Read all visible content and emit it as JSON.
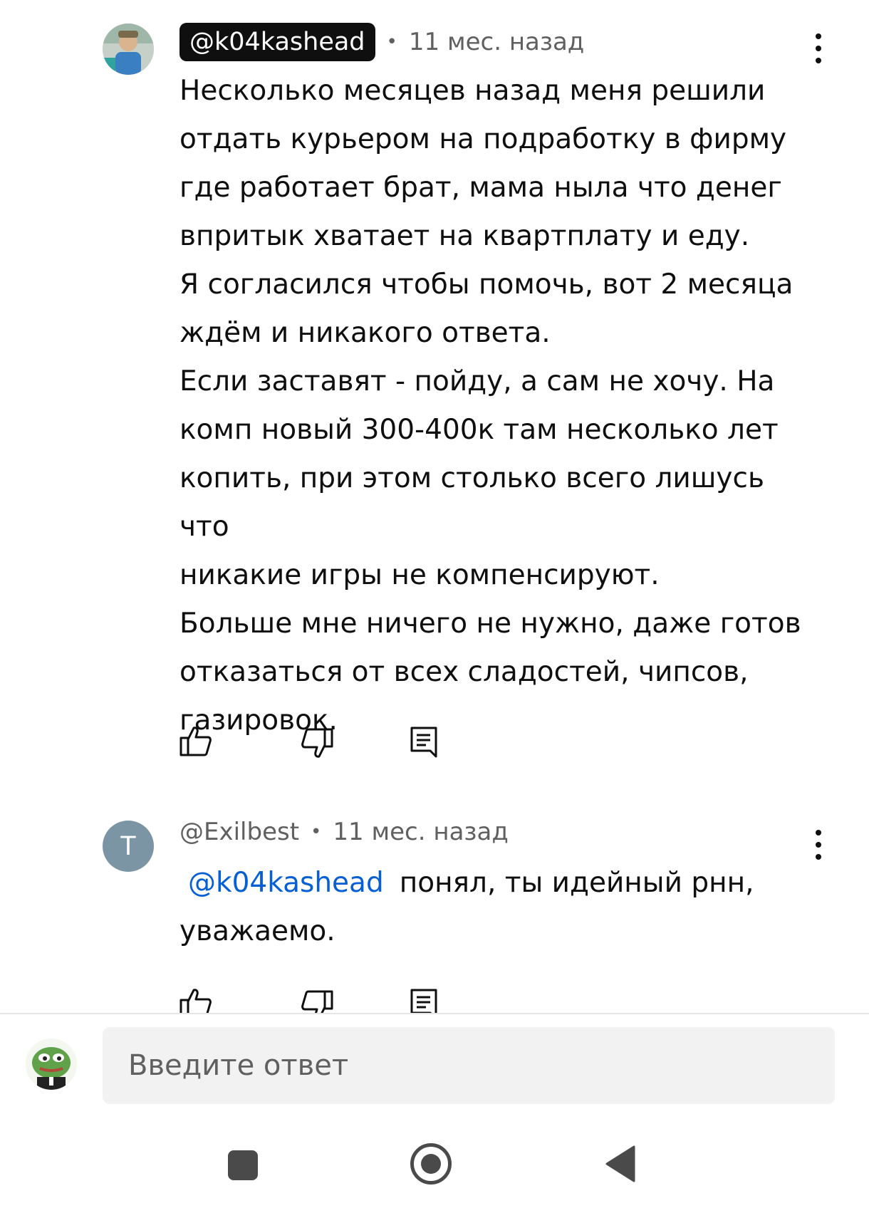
{
  "comments": [
    {
      "handle": "@k04kashead",
      "separator": "•",
      "time": "11 мес. назад",
      "body": "Несколько месяцев назад меня решили\nотдать курьером на подработку в фирму\nгде работает брат, мама ныла что денег\nвпритык хватает на квартплату и еду.\nЯ согласился чтобы помочь, вот 2 месяца\nждём и никакого ответа.\nЕсли заставят - пойду, а сам не хочу. На\nкомп новый 300-400к там несколько лет\nкопить, при этом столько всего лишусь что\nникакие игры не компенсируют.\nБольше мне ничего не нужно, даже готов\nотказаться от всех сладостей, чипсов,\nгазировок."
    },
    {
      "avatar_letter": "T",
      "handle": "@Exilbest",
      "separator": "•",
      "time": "11 мес. назад",
      "mention": "@k04kashead",
      "body_line1": "понял, ты идейный рнн,",
      "body_line2": "уважаемо."
    }
  ],
  "reply_input": {
    "placeholder": "Введите ответ"
  },
  "icons": {
    "like": "thumbs-up-icon",
    "dislike": "thumbs-down-icon",
    "reply": "reply-icon",
    "more": "more-vert-icon"
  },
  "colors": {
    "mention": "#065fd4",
    "badge_bg": "#0f0f0f",
    "letter_avatar": "#7b95a4"
  }
}
